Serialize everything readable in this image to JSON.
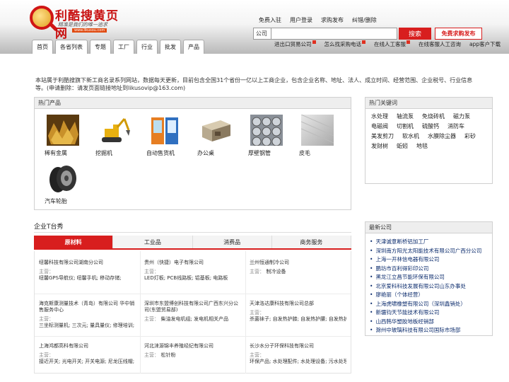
{
  "header": {
    "site_name": "利酷搜黄页网",
    "slogan": "精准是我们的唯一追求",
    "logo_url_text": "www.likusou.com",
    "top_links": [
      "免费入驻",
      "用户登录",
      "求购发布",
      "纠错/删除"
    ],
    "search": {
      "type_label": "公司",
      "placeholder": "",
      "button_label": "搜索"
    },
    "buy_post_label": "免费求购发布",
    "quick_links": [
      "进出口贸易公司",
      "怎么找采购电话",
      "在线人工客服",
      "在线客服人工咨询",
      "app客户下载"
    ]
  },
  "nav": {
    "tabs": [
      "首页",
      "各省列表",
      "专题",
      "工厂",
      "行业",
      "批发",
      "产品"
    ]
  },
  "notice": "本站属于利酷搜旗下新工商名录系列网站，数据每天更新，目前包含全国31个省份一亿以上工商企业，包含企业名称、地址、法人、成立时间、经营范围、企业税号、行业信息等。(申请删除：请发页面链接地址到likusovip@163.com)",
  "hot_products": {
    "title": "热门产品",
    "items": [
      {
        "name": "稀有金属",
        "icon": "rare-metal-icon"
      },
      {
        "name": "挖掘机",
        "icon": "excavator-icon"
      },
      {
        "name": "自动售货机",
        "icon": "vending-machine-icon"
      },
      {
        "name": "办公桌",
        "icon": "office-desk-icon"
      },
      {
        "name": "厚壁钢管",
        "icon": "steel-pipe-icon"
      },
      {
        "name": "皮毛",
        "icon": "fur-icon"
      },
      {
        "name": "汽车轮胎",
        "icon": "car-tire-icon"
      }
    ]
  },
  "hot_keywords": {
    "title": "热门关键词",
    "items": [
      "水处理",
      "轴流泵",
      "免烧砖机",
      "磁力泵",
      "电磁阀",
      "切割机",
      "硫酸钙",
      "消防车",
      "美发剪刀",
      "软水机",
      "水膜除尘器",
      "彩砂",
      "发财树",
      "蚯蚓",
      "地毯"
    ]
  },
  "showcase": {
    "title": "企业T台秀",
    "tabs": [
      "原材料",
      "工业品",
      "消费品",
      "商务服务"
    ],
    "companies": [
      {
        "name": "纽馨科技有限公司湖南分公司",
        "tag": "主营：",
        "desc": "纽馨GPS导航仪; 纽馨手机; 移动存储;"
      },
      {
        "name": "贵州（快捷）电子有限公司",
        "tag": "主营：",
        "desc": "LED灯板; PCB线路板; 铝基板; 电路板"
      },
      {
        "name": "兰州恒通制冷公司",
        "tag": "主营：",
        "desc": "制冷设备"
      },
      {
        "name": "海克斯康测量技术（青岛）有限公司 华中销售服务中心",
        "tag": "主营：",
        "desc": "三坐标测量机; 三次元; 量具量仪; 修理培训;"
      },
      {
        "name": "深圳市东盟博创科技有限公司广西东兴分公司(东盟贸易部)",
        "tag": "主营：",
        "desc": "柴油发电机组; 发电机相关产品"
      },
      {
        "name": "天津洛达康科技有限公司总部",
        "tag": "主营：",
        "desc": "杀菌袜子; 自发热护膝; 自发热护腰; 自发热护"
      },
      {
        "name": "上海鸿都高科有限公司",
        "tag": "主营：",
        "desc": "接近开关; 光电开关; 开关电源; 尼龙压线帽;"
      },
      {
        "name": "河北涞源锦丰养殖经纪有限公司",
        "tag": "主营：",
        "desc": "松针粉"
      },
      {
        "name": "长沙水分子环保科技有限公司",
        "tag": "主营：",
        "desc": "环保产品; 水处理配件; 水处理设备; 污水处理;"
      }
    ]
  },
  "latest": {
    "title": "最新公司",
    "items": [
      "天津诚意断桥铝加工厂",
      "深圳南方阳光太阳能技术有限公司广西分公司",
      "上海一开林信电器有限公司",
      "鹏坊市百利得彩印公司",
      "黑龙江立昌节能环保有限公司",
      "北京爱科科技发展有限公司山东办事处",
      "廖艳丽（个体经营）",
      "上海虎啸橡塑有限公司（深圳鑫销处）",
      "新疆钧天节能技术有限公司",
      "山西韩华塑胶地板经销部",
      "滁州中玻璃科技有限公司国际市场部"
    ]
  }
}
